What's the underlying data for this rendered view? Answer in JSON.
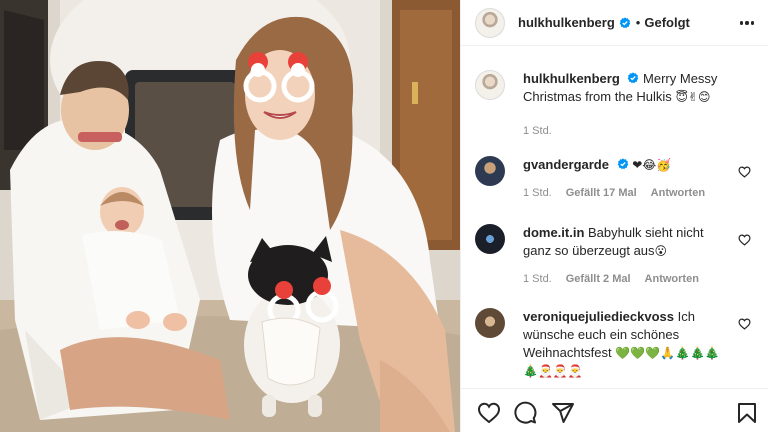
{
  "post": {
    "author": "hulkhulkenberg",
    "follow_status": "Gefolgt",
    "separator": "•",
    "caption": {
      "username": "hulkhulkenberg",
      "text": "Merry Messy Christmas from the Hulkis",
      "emojis": "😇✌😊",
      "time": "1 Std."
    }
  },
  "comments": [
    {
      "username": "gvandergarde",
      "verified": true,
      "text": "",
      "emojis": "❤😂🥳",
      "time": "1 Std.",
      "likes": "Gefällt 17 Mal",
      "reply": "Antworten"
    },
    {
      "username": "dome.it.in",
      "verified": false,
      "text": "Babyhulk sieht nicht ganz so überzeugt aus",
      "emojis": "😮",
      "time": "1 Std.",
      "likes": "Gefällt 2 Mal",
      "reply": "Antworten"
    },
    {
      "username": "veroniquejuliedieckvoss",
      "verified": false,
      "text": "Ich wünsche euch ein schönes Weihnachtsfest",
      "emojis": "💚💚💚🙏🎄🎄🎄 🎄🎅🎅🎅"
    }
  ],
  "icons": {
    "verified": "verified-badge-icon",
    "more": "more-options-icon",
    "like": "heart-icon",
    "comment": "comment-bubble-icon",
    "share": "paper-plane-icon",
    "save": "bookmark-icon"
  },
  "colors": {
    "verified_blue": "#0095f6",
    "muted_text": "#8e8e8e",
    "text": "#262626",
    "divider": "#efefef"
  }
}
